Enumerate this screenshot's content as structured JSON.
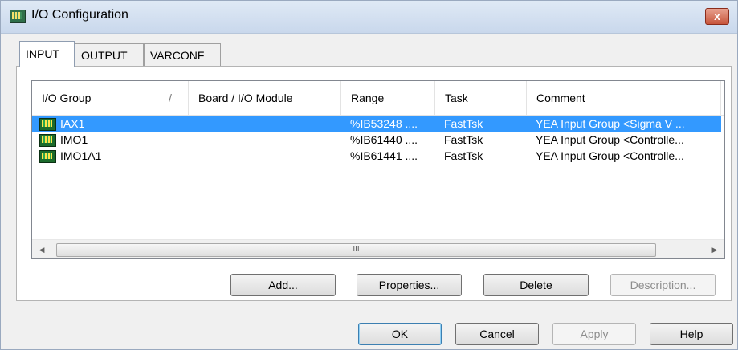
{
  "window": {
    "title": "I/O Configuration",
    "close_glyph": "x"
  },
  "tabs": [
    {
      "label": "INPUT",
      "active": true
    },
    {
      "label": "OUTPUT",
      "active": false
    },
    {
      "label": "VARCONF",
      "active": false
    }
  ],
  "list": {
    "columns": [
      "I/O Group",
      "Board / I/O Module",
      "Range",
      "Task",
      "Comment"
    ],
    "sort_indicator": "/",
    "rows": [
      {
        "group": "IAX1",
        "board": "",
        "range": "%IB53248 ....",
        "task": "FastTsk",
        "comment": "YEA Input Group <Sigma V ...",
        "selected": true
      },
      {
        "group": "IMO1",
        "board": "",
        "range": "%IB61440 ....",
        "task": "FastTsk",
        "comment": "YEA Input Group <Controlle...",
        "selected": false
      },
      {
        "group": "IMO1A1",
        "board": "",
        "range": "%IB61441 ....",
        "task": "FastTsk",
        "comment": "YEA Input Group <Controlle...",
        "selected": false
      }
    ],
    "row_icon": "io-group-icon",
    "scroll_left_glyph": "◀",
    "scroll_right_glyph": "▶",
    "scroll_grip": "III"
  },
  "panel_buttons": {
    "add": "Add...",
    "properties": "Properties...",
    "delete": "Delete",
    "description": "Description..."
  },
  "dialog_buttons": {
    "ok": "OK",
    "cancel": "Cancel",
    "apply": "Apply",
    "help": "Help"
  },
  "colors": {
    "selection": "#3399ff",
    "title_gradient_top": "#dfe9f5",
    "close_button": "#c7553b"
  }
}
